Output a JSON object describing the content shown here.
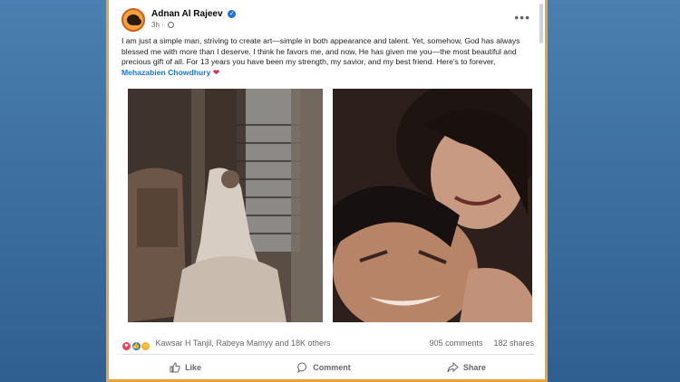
{
  "post": {
    "author": "Adnan Al Rajeev",
    "time": "3h",
    "time_separator": "·",
    "more_label": "•••",
    "caption_text": "I am just a simple man, striving to create art—simple in both appearance and talent. Yet, somehow, God has always blessed me with more than I deserve. I think he favors me, and now, He has given me you—the most beautiful and precious gift of all. For 13 years you have been my strength, my savior, and my best friend. Here's to forever, ",
    "mention": "Mehazabien Chowdhury",
    "heart": "❤"
  },
  "reactions": {
    "names": "Kawsar H Tanjil, Rabeya Mamyy and 18K others",
    "comments": "905 comments",
    "shares": "182 shares"
  },
  "actions": {
    "like": "Like",
    "comment": "Comment",
    "share": "Share"
  },
  "icons": {
    "verified": "verified-badge-icon",
    "globe": "globe-icon",
    "like": "thumbs-up-icon",
    "comment": "comment-bubble-icon",
    "share": "share-arrow-icon"
  },
  "colors": {
    "accent_blue": "#1b74e4",
    "frame_border": "#e8a33d",
    "background": "#3a6d9e"
  }
}
